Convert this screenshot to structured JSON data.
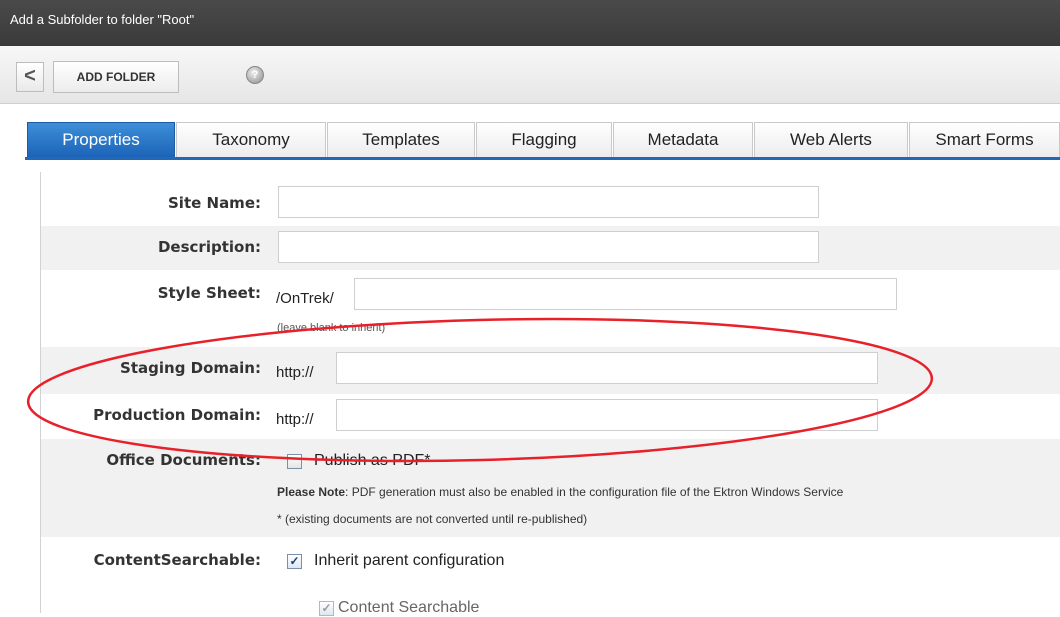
{
  "window": {
    "title": "Add a Subfolder to folder \"Root\""
  },
  "toolbar": {
    "back_label": "<",
    "add_folder_label": "ADD FOLDER",
    "help_label": "?"
  },
  "tabs": [
    {
      "label": "Properties",
      "active": true
    },
    {
      "label": "Taxonomy",
      "active": false
    },
    {
      "label": "Templates",
      "active": false
    },
    {
      "label": "Flagging",
      "active": false
    },
    {
      "label": "Metadata",
      "active": false
    },
    {
      "label": "Web Alerts",
      "active": false
    },
    {
      "label": "Smart Forms",
      "active": false
    }
  ],
  "form": {
    "site_name": {
      "label": "Site Name:",
      "value": ""
    },
    "description": {
      "label": "Description:",
      "value": ""
    },
    "style_sheet": {
      "label": "Style Sheet:",
      "prefix": "/OnTrek/",
      "value": "",
      "hint": "(leave blank to inherit)"
    },
    "staging_domain": {
      "label": "Staging Domain:",
      "prefix": "http://",
      "value": ""
    },
    "production_domain": {
      "label": "Production Domain:",
      "prefix": "http://",
      "value": ""
    },
    "office_documents": {
      "label": "Office Documents:",
      "checkbox_label": "Publish as PDF*",
      "checked": false,
      "note_bold": "Please Note",
      "note_text": ": PDF generation must also be enabled in the configuration file of the Ektron Windows Service",
      "footnote": "* (existing documents are not converted until re-published)"
    },
    "content_searchable": {
      "label": "ContentSearchable:",
      "inherit_label": "Inherit parent configuration",
      "inherit_checked": true,
      "searchable_label": "Content Searchable",
      "searchable_checked": true
    }
  },
  "colors": {
    "annotation": "#e8202a",
    "active_tab": "#1c63b8",
    "title_bar": "#3a3a3a"
  }
}
